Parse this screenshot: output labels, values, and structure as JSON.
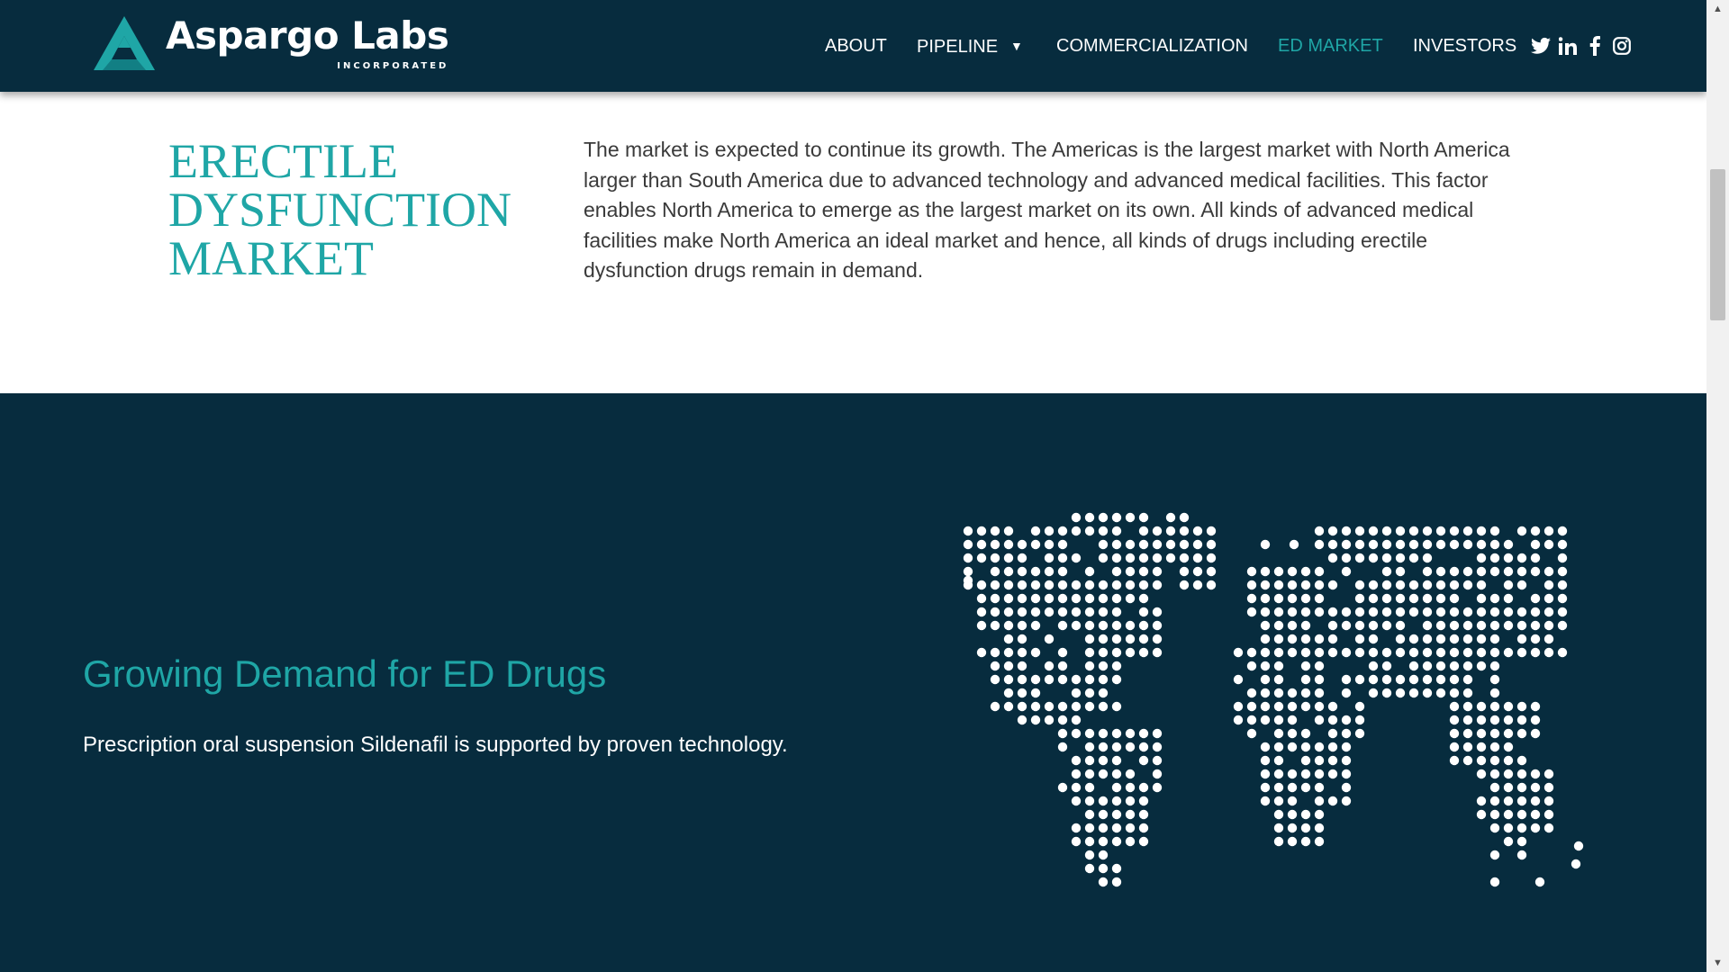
{
  "header": {
    "logo": {
      "name": "Aspargo Labs",
      "subtitle": "INCORPORATED"
    },
    "nav": [
      {
        "label": "ABOUT",
        "active": false
      },
      {
        "label": "PIPELINE",
        "active": false,
        "has_dropdown": true
      },
      {
        "label": "COMMERCIALIZATION",
        "active": false
      },
      {
        "label": "ED MARKET",
        "active": true
      },
      {
        "label": "INVESTORS",
        "active": false
      }
    ],
    "social": [
      "twitter-icon",
      "linkedin-icon",
      "facebook-icon",
      "instagram-icon"
    ]
  },
  "intro": {
    "title": "ERECTILE DYSFUNCTION MARKET",
    "text": "The market is expected to continue its growth. The Americas is the largest market with North America larger than South America due to advanced technology and advanced medical facilities. This factor enables North America to emerge as the largest market on its own. All kinds of advanced medical facilities make North America an ideal market and hence, all kinds of drugs including erectile dysfunction drugs remain in demand."
  },
  "demand": {
    "title": "Growing Demand for ED Drugs",
    "text": "Prescription oral suspension Sildenafil is supported by proven technology."
  },
  "colors": {
    "navy": "#072c3e",
    "teal": "#1fa6a6",
    "body_text": "#3a3a3a"
  }
}
